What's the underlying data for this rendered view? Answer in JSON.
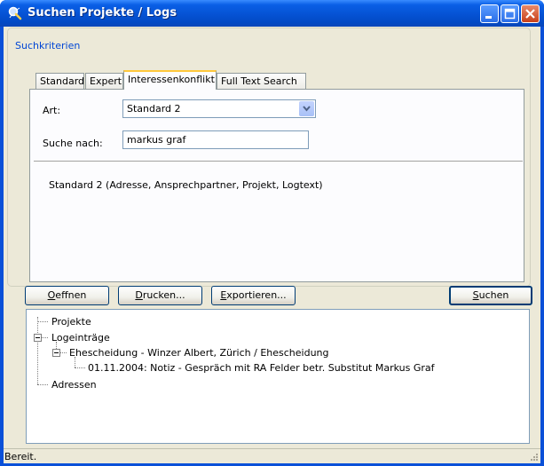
{
  "window": {
    "title": "Suchen Projekte / Logs",
    "icon": "search-app-icon",
    "controls": [
      "minimize-icon",
      "maximize-icon",
      "close-icon"
    ]
  },
  "search_criteria": {
    "legend": "Suchkriterien",
    "tabs": [
      {
        "label": "Standard",
        "active": false
      },
      {
        "label": "Expert",
        "active": false
      },
      {
        "label": "Interessenkonflikt",
        "active": true
      },
      {
        "label": "Full Text Search",
        "active": false
      }
    ],
    "art_label": "Art:",
    "art_value": "Standard 2",
    "suche_label": "Suche nach:",
    "suche_value": "markus graf",
    "description": "Standard 2 (Adresse, Ansprechpartner, Projekt, Logtext)"
  },
  "buttons": {
    "oeffnen": {
      "mnemonic": "O",
      "rest": "effnen"
    },
    "drucken": {
      "mnemonic": "D",
      "rest": "rucken..."
    },
    "exportieren": {
      "mnemonic": "E",
      "rest": "xportieren..."
    },
    "suchen": {
      "mnemonic": "S",
      "rest": "uchen"
    }
  },
  "results": {
    "projekte": "Projekte",
    "logeintraege": "Logeinträge",
    "ehescheidung": "Ehescheidung - Winzer Albert, Zürich / Ehescheidung",
    "log_entry": "01.11.2004: Notiz - Gespräch mit RA Felder betr. Substitut Markus Graf",
    "adressen": "Adressen"
  },
  "status": {
    "text": "Bereit."
  },
  "colors": {
    "titlebar": "#0654d6",
    "client": "#ece9d8",
    "group_legend": "#0046d5",
    "tab_highlight": "#ffc83c"
  }
}
